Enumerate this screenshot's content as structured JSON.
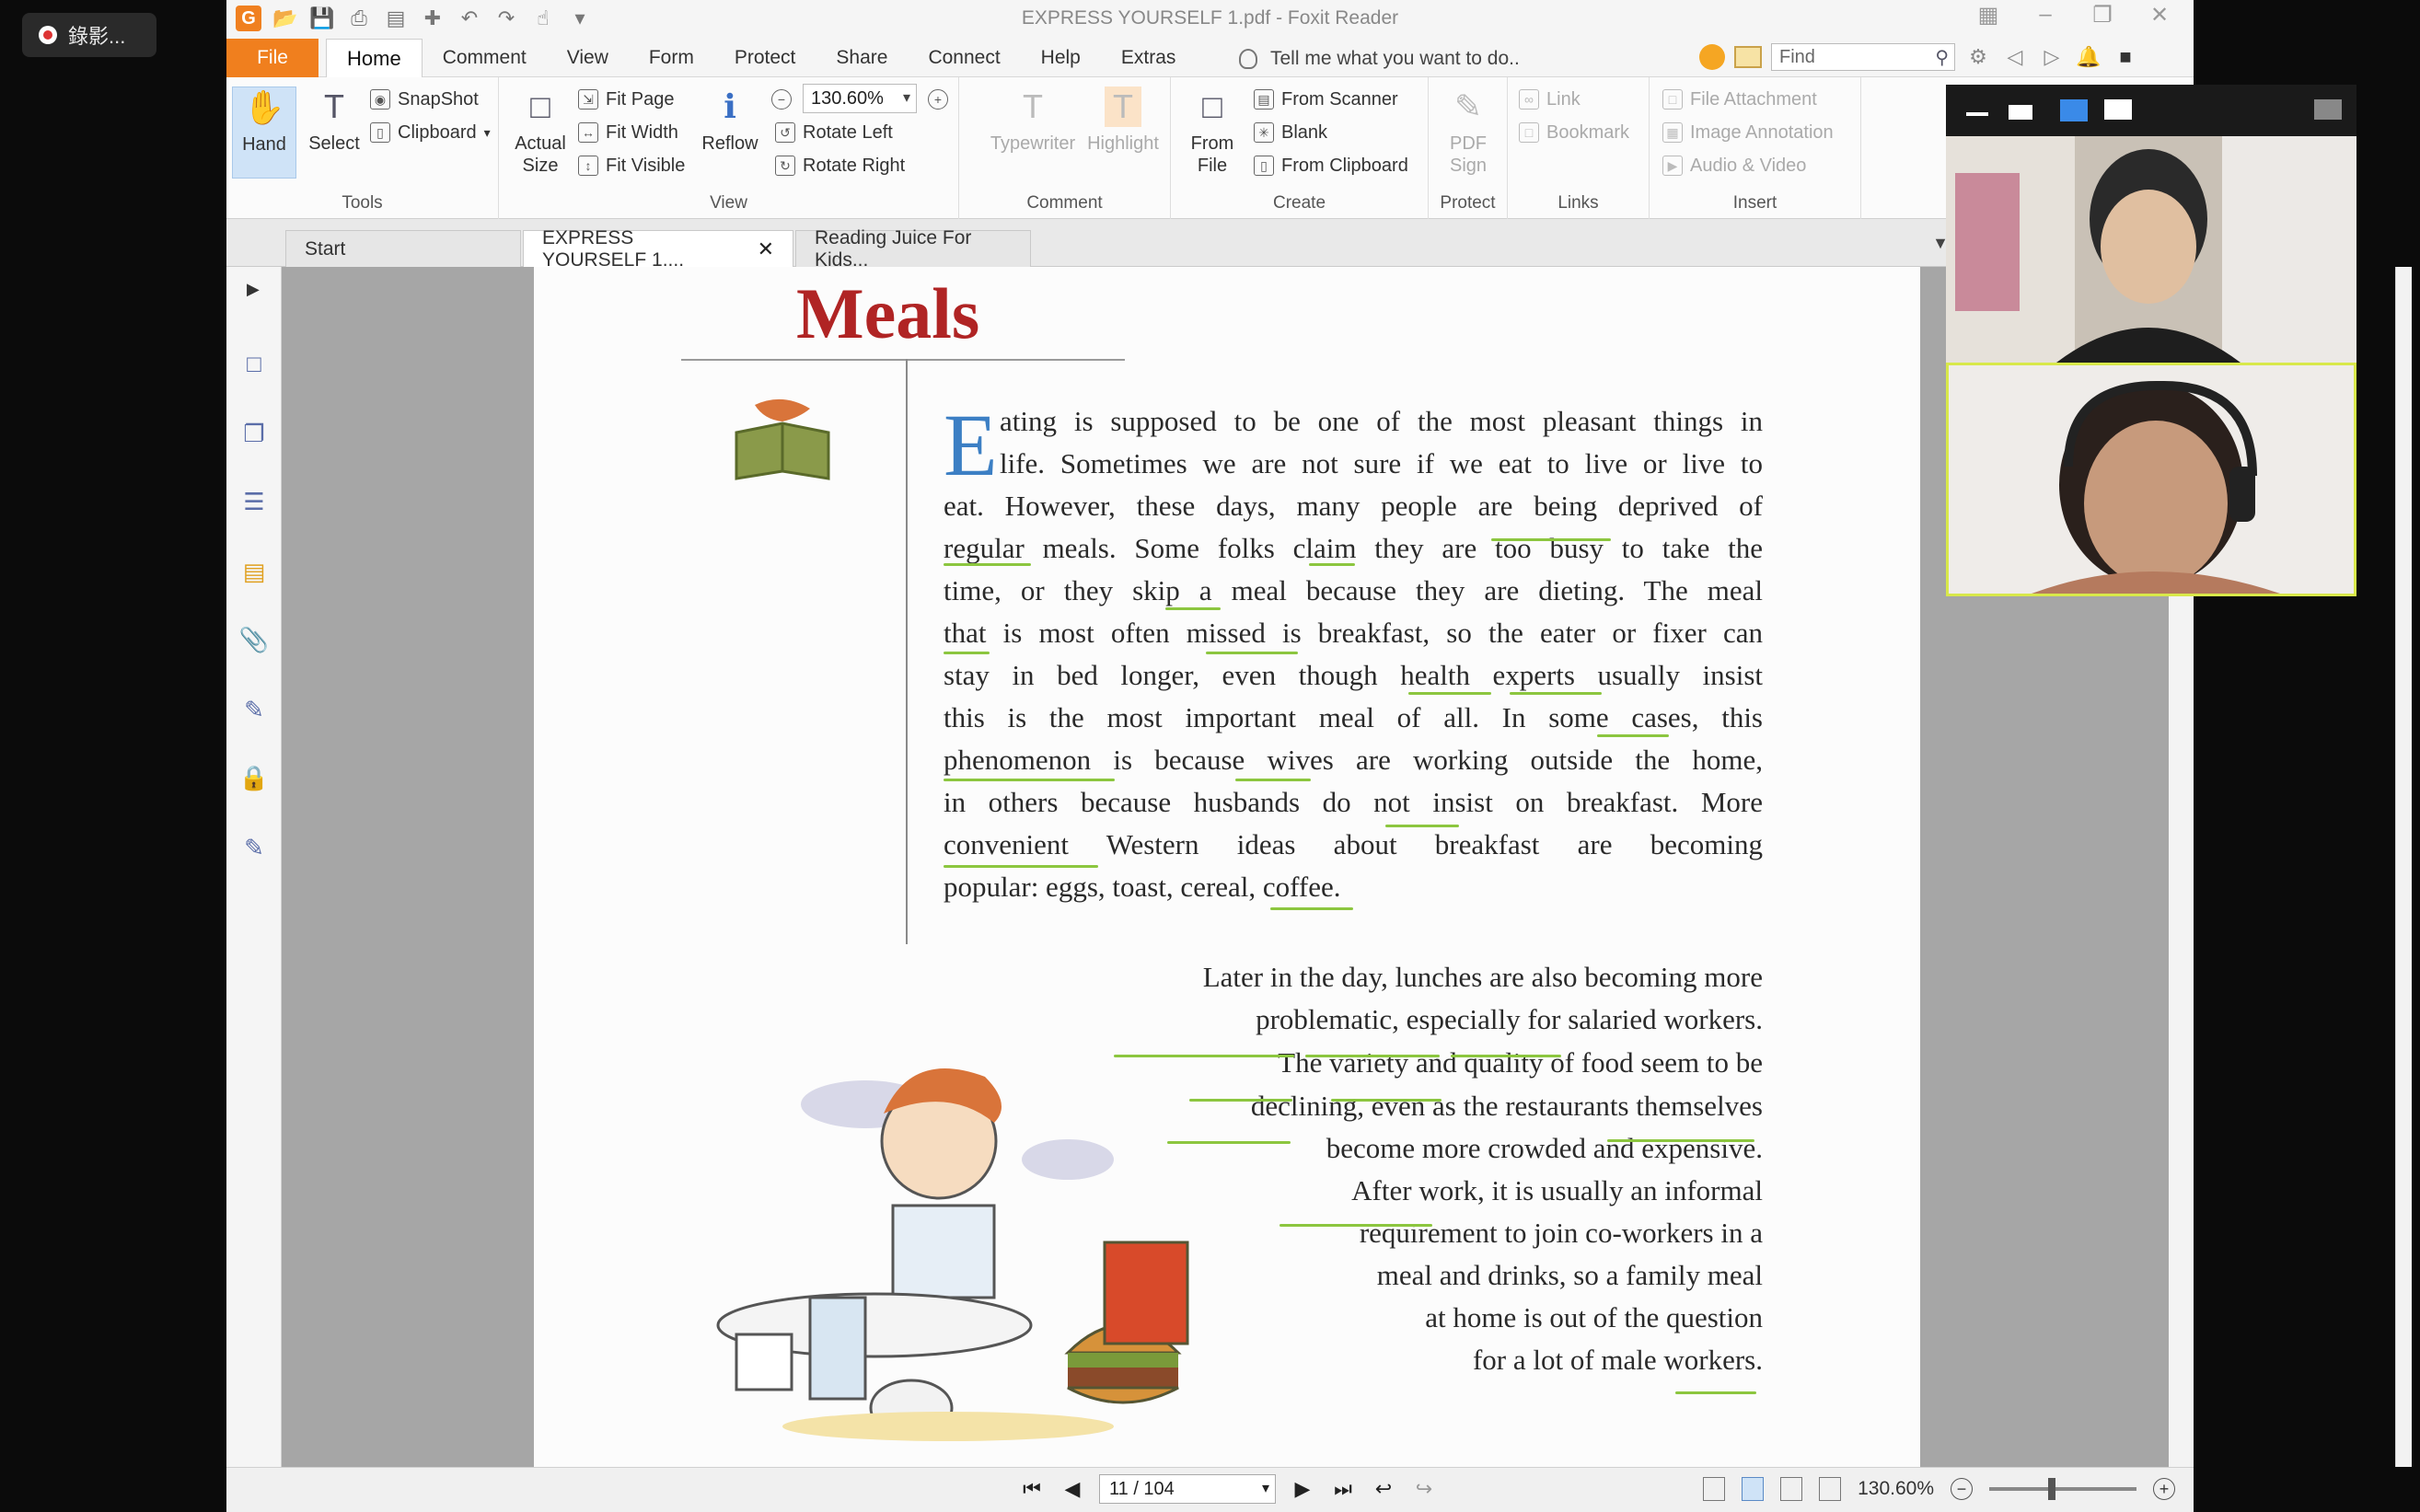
{
  "recorder": {
    "label": "錄影..."
  },
  "window": {
    "title": "EXPRESS YOURSELF 1.pdf - Foxit Reader"
  },
  "menu": {
    "file": "File",
    "items": [
      "Home",
      "Comment",
      "View",
      "Form",
      "Protect",
      "Share",
      "Connect",
      "Help",
      "Extras"
    ],
    "tell_me": "Tell me what you want to do..",
    "find_placeholder": "Find"
  },
  "ribbon": {
    "tools": {
      "label": "Tools",
      "hand": "Hand",
      "select": "Select",
      "snapshot": "SnapShot",
      "clipboard": "Clipboard"
    },
    "view": {
      "label": "View",
      "actual_size": "Actual Size",
      "fit_page": "Fit Page",
      "fit_width": "Fit Width",
      "fit_visible": "Fit Visible",
      "reflow": "Reflow",
      "zoom": "130.60%",
      "rotate_left": "Rotate Left",
      "rotate_right": "Rotate Right"
    },
    "comment": {
      "label": "Comment",
      "typewriter": "Typewriter",
      "highlight": "Highlight"
    },
    "create": {
      "label": "Create",
      "from_file": "From File",
      "from_scanner": "From Scanner",
      "blank": "Blank",
      "from_clipboard": "From Clipboard"
    },
    "protect": {
      "label": "Protect",
      "pdf_sign": "PDF Sign"
    },
    "links": {
      "label": "Links",
      "link": "Link",
      "bookmark": "Bookmark"
    },
    "insert": {
      "label": "Insert",
      "file_attachment": "File Attachment",
      "image_annotation": "Image Annotation",
      "audio_video": "Audio & Video"
    }
  },
  "tabs": [
    "Start",
    "EXPRESS YOURSELF 1....",
    "Reading Juice For Kids..."
  ],
  "document": {
    "title": "Meals",
    "para1": {
      "dropcap": "E",
      "lines": [
        "ating is supposed to be one of the most pleasant things in",
        "life. Sometimes we are not sure if we eat to live or live to",
        "eat. However, these days, many people are being deprived of",
        "regular meals. Some folks claim they are too busy to take the",
        "time, or they skip a meal because they are dieting. The meal",
        "that is most often missed is breakfast, so the eater or fixer can",
        "stay in bed longer, even though health experts usually insist",
        "this is the most important meal of all. In some cases, this",
        "phenomenon is because wives are working outside the home,",
        "in others because husbands do not insist on breakfast. More",
        "convenient Western ideas about breakfast are becoming",
        "popular: eggs, toast, cereal, coffee."
      ]
    },
    "para2": {
      "lines": [
        "Later in the day, lunches are also becoming more",
        "problematic, especially for salaried workers.",
        "The variety and quality of food seem to be",
        "declining, even as the restaurants themselves",
        "become more crowded and expensive.",
        "After work, it is usually an informal",
        "requirement to join co-workers in a",
        "meal and drinks, so a family meal",
        "at home is out of the question",
        "for a lot of male workers."
      ]
    }
  },
  "statusbar": {
    "page": "11 / 104",
    "zoom": "130.60%"
  },
  "colors": {
    "accent": "#f07f1e",
    "title_red": "#b02424",
    "dropcap_blue": "#3c7fc4",
    "underline_green": "#8cc63f",
    "video_highlight": "#d8e84a"
  }
}
